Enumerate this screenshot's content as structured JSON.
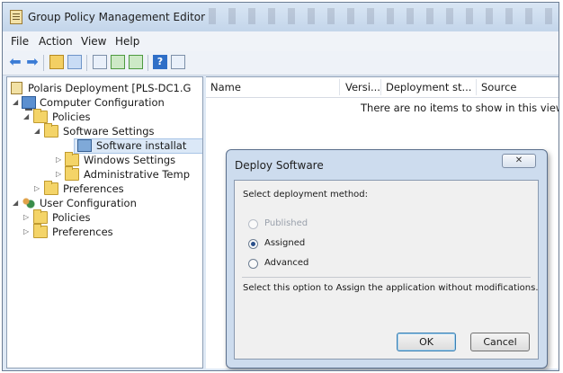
{
  "window": {
    "title": "Group Policy Management Editor",
    "icon": "gpo-editor-icon"
  },
  "menu": [
    "File",
    "Action",
    "View",
    "Help"
  ],
  "toolbar_icons": [
    "back-arrow-icon",
    "forward-arrow-icon",
    "folder-up-icon",
    "show-hide-tree-icon",
    "properties-icon",
    "refresh-icon",
    "export-list-icon",
    "help-icon",
    "console-view-icon"
  ],
  "tree": {
    "root": "Polaris Deployment [PLS-DC1.G",
    "computer_configuration": "Computer Configuration",
    "policies": "Policies",
    "software_settings": "Software Settings",
    "software_installation": "Software installat",
    "windows_settings": "Windows Settings",
    "administrative_templates": "Administrative Temp",
    "preferences": "Preferences",
    "user_configuration": "User Configuration",
    "user_policies": "Policies",
    "user_preferences": "Preferences"
  },
  "list": {
    "columns": [
      "Name",
      "Versi...",
      "Deployment st...",
      "Source"
    ],
    "empty_message": "There are no items to show in this view."
  },
  "dialog": {
    "title": "Deploy Software",
    "close_label": "✕",
    "prompt": "Select deployment method:",
    "options": [
      {
        "label": "Published",
        "state": "disabled"
      },
      {
        "label": "Assigned",
        "state": "selected"
      },
      {
        "label": "Advanced",
        "state": "unselected"
      }
    ],
    "description": "Select this option to Assign the application without modifications.",
    "ok_label": "OK",
    "cancel_label": "Cancel"
  },
  "colors": {
    "titlebar": "#c3d5ea",
    "selection": "#dbe8f7",
    "dialog_frame": "#cddcee"
  }
}
